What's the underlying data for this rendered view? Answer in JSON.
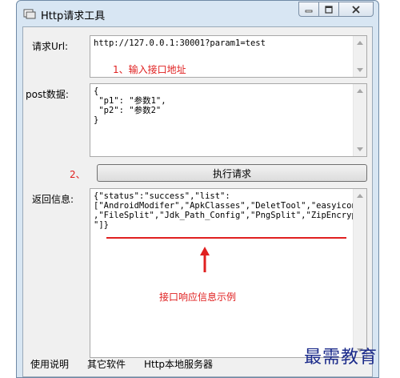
{
  "window": {
    "title": "Http请求工具"
  },
  "form": {
    "url_label": "请求Url:",
    "url_value": "http://127.0.0.1:30001?param1=test",
    "url_hint": "1、输入接口地址",
    "post_label": "post数据:",
    "post_lines": [
      "{",
      " \"p1\": \"参数1\",",
      " \"p2\": \"参数2\"",
      "}"
    ],
    "exec_step": "2、",
    "exec_button": "执行请求",
    "response_label": "返回信息:",
    "response_lines": [
      "{\"status\":\"success\",\"list\":",
      "[\"AndroidModifer\",\"ApkClasses\",\"DeletTool\",\"easyicon\"",
      ",\"FileSplit\",\"Jdk_Path_Config\",\"PngSplit\",\"ZipEncrypt",
      "\"]}"
    ],
    "response_annotation": "接口响应信息示例"
  },
  "bottom_links": [
    "使用说明",
    "其它软件",
    "Http本地服务器"
  ],
  "watermark": "最需教育",
  "colors": {
    "annotation": "#e02020",
    "watermark": "#1a2a8a"
  }
}
